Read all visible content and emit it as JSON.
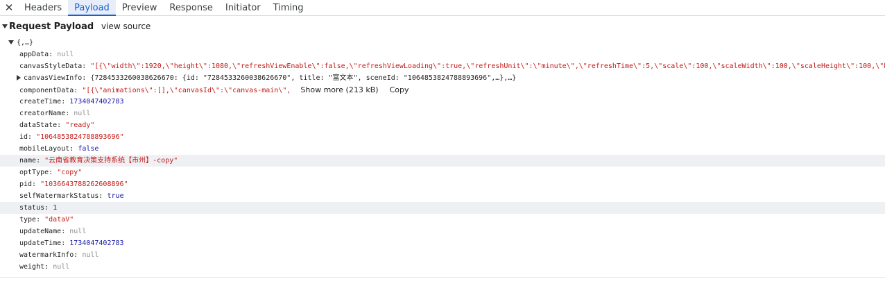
{
  "tabs": [
    {
      "label": "Headers"
    },
    {
      "label": "Payload"
    },
    {
      "label": "Preview"
    },
    {
      "label": "Response"
    },
    {
      "label": "Initiator"
    },
    {
      "label": "Timing"
    }
  ],
  "close_glyph": "✕",
  "section": {
    "title": "Request Payload",
    "view_source": "view source"
  },
  "root_label": "{,…}",
  "fields": {
    "appData": {
      "key": "appData:",
      "value": "null"
    },
    "canvasStyleData": {
      "key": "canvasStyleData:",
      "value": "\"[{\\\"width\\\":1920,\\\"height\\\":1080,\\\"refreshViewEnable\\\":false,\\\"refreshViewLoading\\\":true,\\\"refreshUnit\\\":\\\"minute\\\",\\\"refreshTime\\\":5,\\\"scale\\\":100,\\\"scaleWidth\\\":100,\\\"scaleHeight\\\":100,\\\"ba"
    },
    "canvasViewInfo": {
      "key": "canvasViewInfo:",
      "value": "{7284533260038626670: {id: \"7284533260038626670\", title: \"富文本\", sceneId: \"1064853824788893696\",…},…}"
    },
    "componentData": {
      "key": "componentData:",
      "value": "\"[{\\\"animations\\\":[],\\\"canvasId\\\":\\\"canvas-main\\\",",
      "show_more": "Show more (213 kB)",
      "copy": "Copy"
    },
    "createTime": {
      "key": "createTime:",
      "value": "1734047402783"
    },
    "creatorName": {
      "key": "creatorName:",
      "value": "null"
    },
    "dataState": {
      "key": "dataState:",
      "value": "\"ready\""
    },
    "id": {
      "key": "id:",
      "value": "\"1064853824788893696\""
    },
    "mobileLayout": {
      "key": "mobileLayout:",
      "value": "false"
    },
    "name": {
      "key": "name:",
      "value": "\"云南省教育决策支持系统【市州】-copy\""
    },
    "optType": {
      "key": "optType:",
      "value": "\"copy\""
    },
    "pid": {
      "key": "pid:",
      "value": "\"1036643788262608896\""
    },
    "selfWatermarkStatus": {
      "key": "selfWatermarkStatus:",
      "value": "true"
    },
    "status": {
      "key": "status:",
      "value": "1"
    },
    "type": {
      "key": "type:",
      "value": "\"dataV\""
    },
    "updateName": {
      "key": "updateName:",
      "value": "null"
    },
    "updateTime": {
      "key": "updateTime:",
      "value": "1734047402783"
    },
    "watermarkInfo": {
      "key": "watermarkInfo:",
      "value": "null"
    },
    "weight": {
      "key": "weight:",
      "value": "null"
    }
  },
  "colors": {
    "accent": "#1a5fd1",
    "string": "#c41a16",
    "number": "#1a1aa6",
    "null": "#909090",
    "row_highlight": "#eef0f4"
  },
  "icons": {
    "close": "close-icon",
    "collapse": "triangle-down-icon",
    "expand": "triangle-right-icon"
  }
}
